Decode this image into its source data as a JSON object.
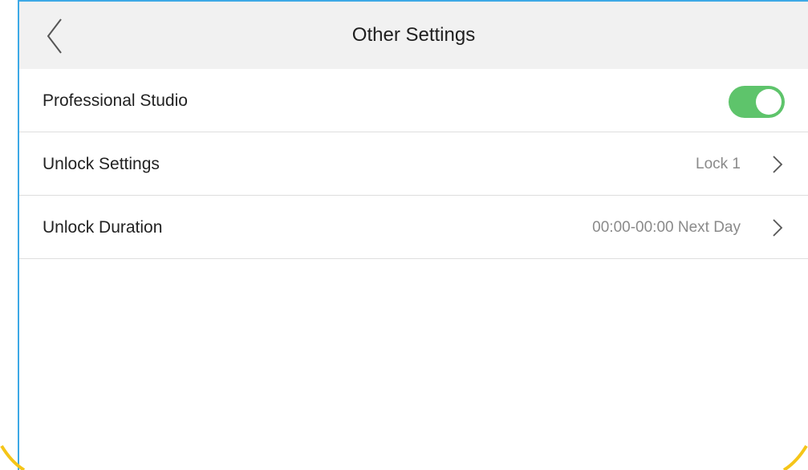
{
  "header": {
    "title": "Other Settings",
    "back_icon": "chevron-left-icon"
  },
  "rows": [
    {
      "label": "Professional Studio",
      "control": "toggle",
      "toggle_on": true,
      "toggle_color": "#5ec46b"
    },
    {
      "label": "Unlock Settings",
      "value": "Lock 1",
      "icon": "chevron-right-icon"
    },
    {
      "label": "Unlock Duration",
      "value": "00:00-00:00 Next Day",
      "icon": "chevron-right-icon"
    }
  ],
  "colors": {
    "header_bg": "#f1f1f1",
    "frame_border": "#3da9e6",
    "corner_accent": "#f5c518",
    "divider": "#dedede"
  }
}
